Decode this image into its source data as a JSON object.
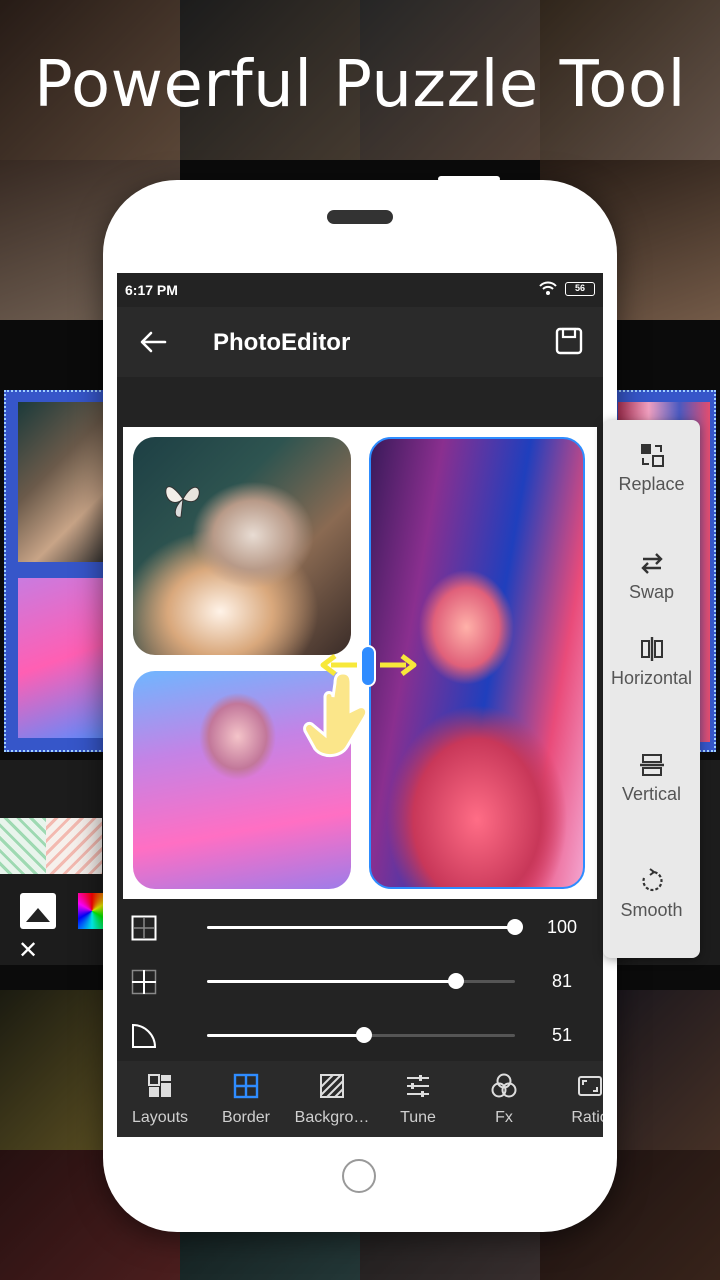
{
  "headline": "Powerful Puzzle Tool",
  "phone": {
    "status": {
      "time": "6:17 PM",
      "battery": "56"
    },
    "app_title": "PhotoEditor",
    "sliders": [
      {
        "icon": "border-outer-icon",
        "value": "100",
        "level": 1.0
      },
      {
        "icon": "border-inner-icon",
        "value": "81",
        "level": 0.81
      },
      {
        "icon": "corner-radius-icon",
        "value": "51",
        "level": 0.51
      }
    ],
    "tabs": [
      {
        "label": "Layouts",
        "icon": "layouts-icon"
      },
      {
        "label": "Border",
        "icon": "border-icon",
        "active": true
      },
      {
        "label": "Backgro…",
        "icon": "background-icon"
      },
      {
        "label": "Tune",
        "icon": "tune-icon"
      },
      {
        "label": "Fx",
        "icon": "fx-icon"
      },
      {
        "label": "Ratio",
        "icon": "ratio-icon"
      }
    ]
  },
  "context_menu": [
    {
      "label": "Replace",
      "icon": "replace-icon"
    },
    {
      "label": "Swap",
      "icon": "swap-icon"
    },
    {
      "label": "Horizontal",
      "icon": "horizontal-split-icon"
    },
    {
      "label": "Vertical",
      "icon": "vertical-split-icon"
    },
    {
      "label": "Smooth",
      "icon": "smooth-icon"
    }
  ],
  "colors": {
    "accent": "#2f8cff",
    "screen_bg": "#232323",
    "menu_bg": "#e9e9e9",
    "panel_blue": "#3656c9"
  }
}
